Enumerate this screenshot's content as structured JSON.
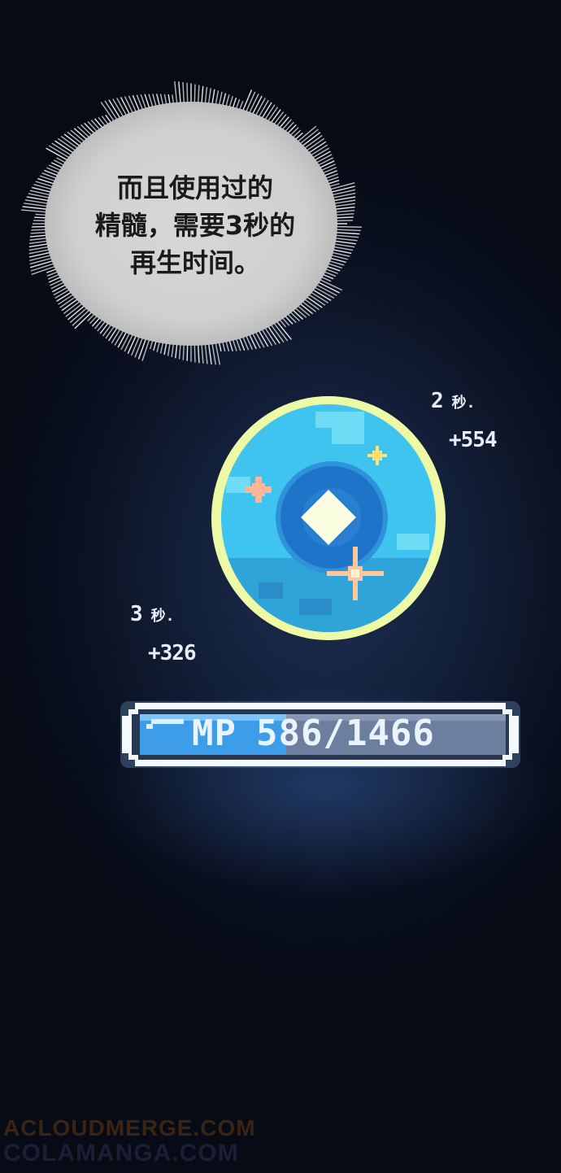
{
  "speech_bubble": {
    "line1": "而且使用过的",
    "line2": "精髓，需要3秒的",
    "line3": "再生时间。"
  },
  "timer_right": {
    "value": "2",
    "unit": "秒."
  },
  "gain_right": "+554",
  "timer_left": {
    "value": "3",
    "unit": "秒."
  },
  "gain_left": "+326",
  "mp_bar": {
    "label": "MP",
    "current": "586/1466",
    "fill_fraction": 0.4,
    "fill_color": "#3d9de8",
    "empty_color": "#6c7f9e"
  },
  "orb": {
    "color": "#3fc4f0",
    "rim_color": "#eef9a6",
    "core_color": "#1e74c8"
  },
  "watermark": {
    "line1": "ACLOUDMERGE.COM",
    "line2": "COLAMANGA.COM"
  }
}
